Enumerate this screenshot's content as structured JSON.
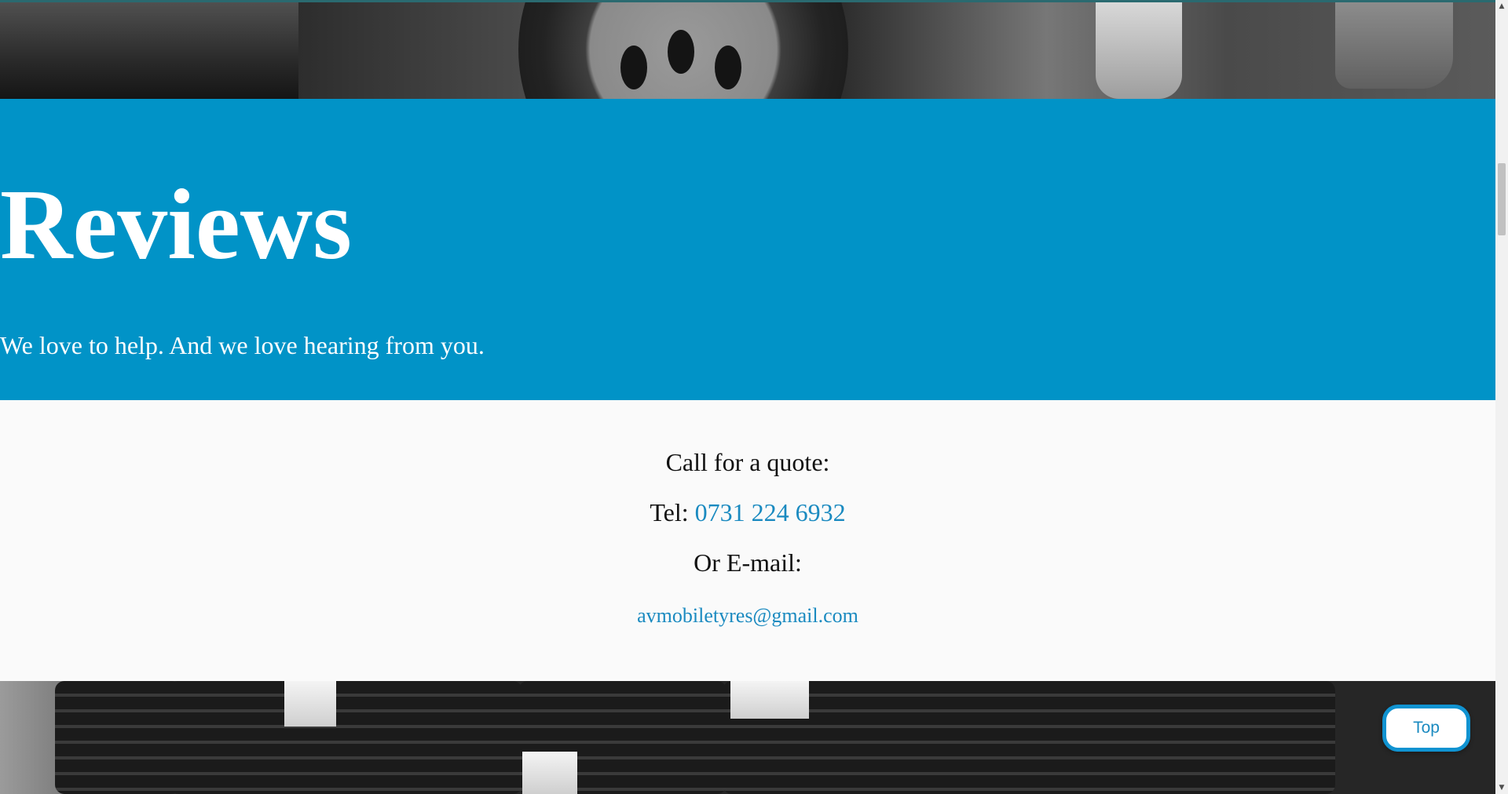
{
  "reviews": {
    "title": "Reviews",
    "subtitle": "We love to help. And we love hearing from you."
  },
  "contact": {
    "call_label": "Call for a quote:",
    "tel_label": "Tel:",
    "tel_number": "0731 224 6932",
    "email_label": "Or E-mail:",
    "email": "avmobiletyres@gmail.com"
  },
  "top_button": {
    "label": "Top"
  },
  "scrollbar": {
    "up_arrow": "▲",
    "down_arrow": "▼"
  },
  "colors": {
    "banner_blue": "#0193c7",
    "link_blue": "#1a8ac0",
    "button_border": "#1093d1",
    "page_bg": "#fafafa"
  }
}
